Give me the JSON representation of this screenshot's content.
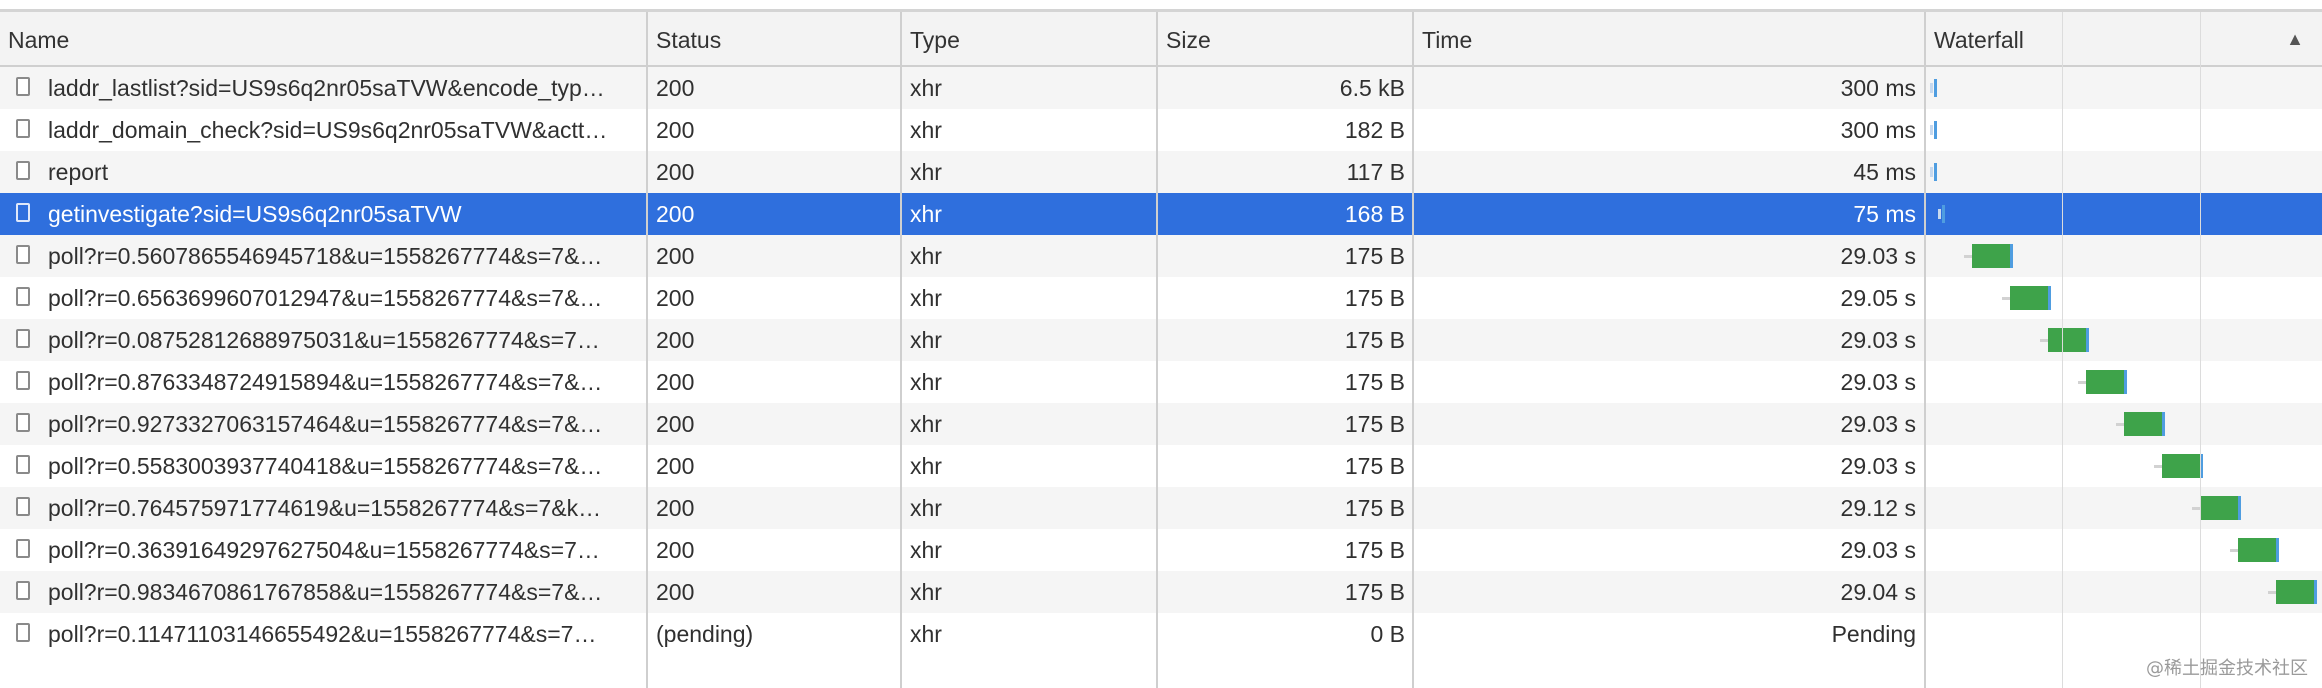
{
  "columns": {
    "name": "Name",
    "status": "Status",
    "type": "Type",
    "size": "Size",
    "time": "Time",
    "waterfall": "Waterfall"
  },
  "sort_indicator": "▲",
  "rows": [
    {
      "name": "laddr_lastlist?sid=US9s6q2nr05saTVW&encode_typ…",
      "status": "200",
      "type": "xhr",
      "size": "6.5 kB",
      "time": "300 ms"
    },
    {
      "name": "laddr_domain_check?sid=US9s6q2nr05saTVW&actt…",
      "status": "200",
      "type": "xhr",
      "size": "182 B",
      "time": "300 ms"
    },
    {
      "name": "report",
      "status": "200",
      "type": "xhr",
      "size": "117 B",
      "time": "45 ms"
    },
    {
      "name": "getinvestigate?sid=US9s6q2nr05saTVW",
      "status": "200",
      "type": "xhr",
      "size": "168 B",
      "time": "75 ms",
      "selected": true
    },
    {
      "name": "poll?r=0.5607865546945718&u=1558267774&s=7&…",
      "status": "200",
      "type": "xhr",
      "size": "175 B",
      "time": "29.03 s"
    },
    {
      "name": "poll?r=0.6563699607012947&u=1558267774&s=7&…",
      "status": "200",
      "type": "xhr",
      "size": "175 B",
      "time": "29.05 s"
    },
    {
      "name": "poll?r=0.08752812688975031&u=1558267774&s=7…",
      "status": "200",
      "type": "xhr",
      "size": "175 B",
      "time": "29.03 s"
    },
    {
      "name": "poll?r=0.8763348724915894&u=1558267774&s=7&…",
      "status": "200",
      "type": "xhr",
      "size": "175 B",
      "time": "29.03 s"
    },
    {
      "name": "poll?r=0.9273327063157464&u=1558267774&s=7&…",
      "status": "200",
      "type": "xhr",
      "size": "175 B",
      "time": "29.03 s"
    },
    {
      "name": "poll?r=0.5583003937740418&u=1558267774&s=7&…",
      "status": "200",
      "type": "xhr",
      "size": "175 B",
      "time": "29.03 s"
    },
    {
      "name": "poll?r=0.764575971774619&u=1558267774&s=7&k…",
      "status": "200",
      "type": "xhr",
      "size": "175 B",
      "time": "29.12 s"
    },
    {
      "name": "poll?r=0.36391649297627504&u=1558267774&s=7…",
      "status": "200",
      "type": "xhr",
      "size": "175 B",
      "time": "29.03 s"
    },
    {
      "name": "poll?r=0.9834670861767858&u=1558267774&s=7&…",
      "status": "200",
      "type": "xhr",
      "size": "175 B",
      "time": "29.04 s"
    },
    {
      "name": "poll?r=0.11471103146655492&u=1558267774&s=7…",
      "status": "(pending)",
      "type": "xhr",
      "size": "0 B",
      "time": "Pending"
    }
  ],
  "watermark": "@稀土掘金技术社区",
  "colors": {
    "selected_row": "#2f6fdd",
    "bar_green": "#3ea34a",
    "bar_blue": "#4f9de0"
  }
}
